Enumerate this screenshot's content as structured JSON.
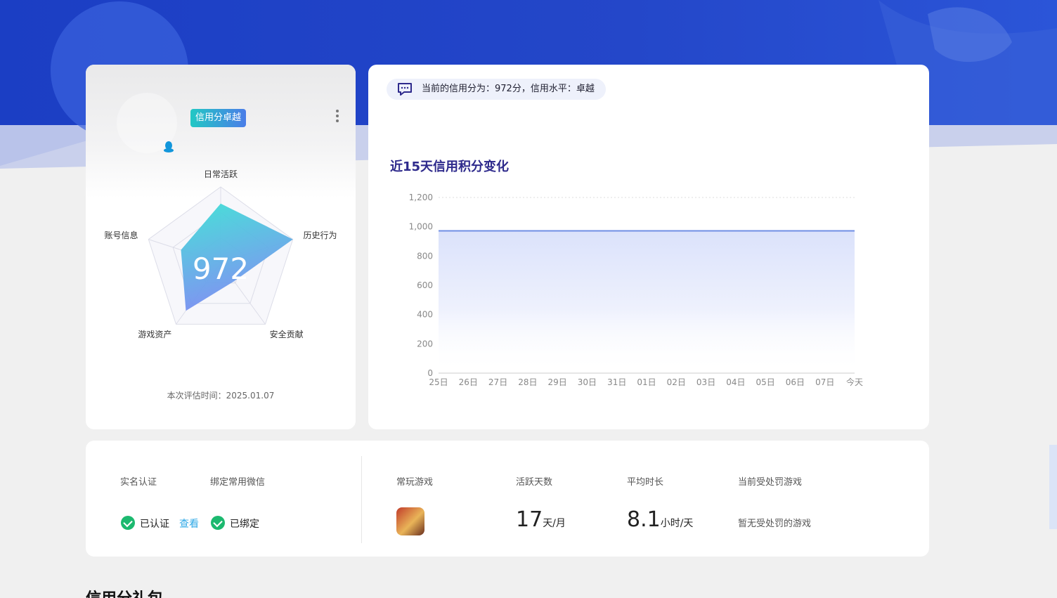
{
  "profile": {
    "badge": "信用分卓越",
    "score": "972",
    "dimensions": [
      "日常活跃",
      "历史行为",
      "安全贡献",
      "游戏资产",
      "账号信息"
    ],
    "dimension_values": [
      0.78,
      1.0,
      0.3,
      0.78,
      0.55
    ],
    "eval_time": "本次评估时间：2025.01.07"
  },
  "notice": {
    "text": "当前的信用分为：972分，信用水平：卓越"
  },
  "chart_title": "近15天信用积分变化",
  "chart_data": {
    "type": "area",
    "title": "近15天信用积分变化",
    "categories": [
      "25日",
      "26日",
      "27日",
      "28日",
      "29日",
      "30日",
      "31日",
      "01日",
      "02日",
      "03日",
      "04日",
      "05日",
      "06日",
      "07日",
      "今天"
    ],
    "series": [
      {
        "values": [
          972,
          972,
          972,
          972,
          972,
          972,
          972,
          972,
          972,
          972,
          972,
          972,
          972,
          972,
          972
        ]
      }
    ],
    "ylim": [
      0,
      1200
    ],
    "yticks": [
      "0",
      "200",
      "400",
      "600",
      "800",
      "1,000",
      "1,200"
    ],
    "grid": true,
    "color": "#6f8fe4"
  },
  "stats": {
    "realname_label": "实名认证",
    "realname_status": "已认证",
    "realname_link": "查看",
    "wechat_label": "绑定常用微信",
    "wechat_status": "已绑定",
    "games_label": "常玩游戏",
    "active_label": "活跃天数",
    "active_value": "17",
    "active_unit": "天/月",
    "duration_label": "平均时长",
    "duration_value": "8.1",
    "duration_unit": "小时/天",
    "penalty_label": "当前受处罚游戏",
    "penalty_value": "暂无受处罚的游戏"
  },
  "section_title": "信用分礼包",
  "colors": {
    "hero": "#1f3fc3",
    "accent": "#1cb96f",
    "link": "#2ea8e6"
  }
}
